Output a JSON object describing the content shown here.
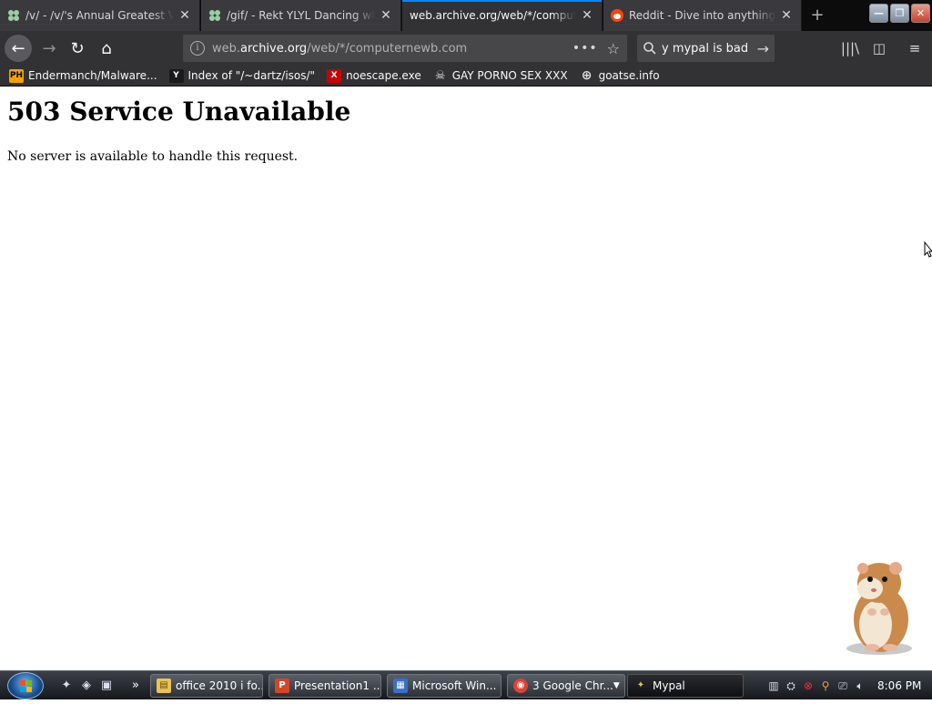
{
  "browser": {
    "tabs": [
      {
        "title": "/v/ - /v/'s Annual Greatest Vide",
        "favicon": "4chan-clover-icon",
        "close": "✕",
        "active": false
      },
      {
        "title": "/gif/ - Rekt YLYL Dancing whi",
        "favicon": "4chan-clover-icon",
        "close": "✕",
        "active": false
      },
      {
        "title": "web.archive.org/web/*/computerne",
        "favicon": "",
        "close": "✕",
        "active": true
      },
      {
        "title": "Reddit - Dive into anything",
        "favicon": "reddit-icon",
        "close": "✕",
        "active": false
      }
    ],
    "new_tab_label": "+",
    "window_buttons": {
      "minimize": "—",
      "restore": "❐",
      "close": "✕"
    }
  },
  "navbar": {
    "back": "←",
    "forward": "→",
    "reload": "↻",
    "home": "⌂",
    "url_prefix": "web.",
    "url_domain": "archive.org",
    "url_path": "/web/*/computernewb.com",
    "page_actions": "•••",
    "bookmark_star": "☆",
    "search_query": "y mypal is bad",
    "search_go": "→",
    "library_icon": "|||\\",
    "sidebar_icon": "◫",
    "menu_icon": "≡"
  },
  "bookmarks": [
    {
      "label": "Endermanch/Malware...",
      "icon_text": "PH"
    },
    {
      "label": "Index of \"/~dartz/isos/\"",
      "icon_text": "Y"
    },
    {
      "label": "noescape.exe",
      "icon_text": "X"
    },
    {
      "label": "GAY PORNO SEX XXX",
      "icon_text": "☠"
    },
    {
      "label": "goatse.info",
      "icon_text": "⊕"
    }
  ],
  "page": {
    "heading": "503 Service Unavailable",
    "message": "No server is available to handle this request."
  },
  "taskbar": {
    "items": [
      {
        "label": "office 2010 i fo...",
        "icon": "folder-icon",
        "icon_text": "▤",
        "active": false
      },
      {
        "label": "Presentation1 ...",
        "icon": "powerpoint-icon",
        "icon_text": "P",
        "active": false
      },
      {
        "label": "Microsoft Win...",
        "icon": "windows-icon",
        "icon_text": "▦",
        "active": false
      },
      {
        "label": "3 Google Chr...",
        "icon": "chrome-icon",
        "icon_text": "◉",
        "active": false
      },
      {
        "label": "Mypal",
        "icon": "mypal-icon",
        "icon_text": "✦",
        "active": true
      }
    ],
    "overflow": "»",
    "clock": "8:06 PM"
  }
}
